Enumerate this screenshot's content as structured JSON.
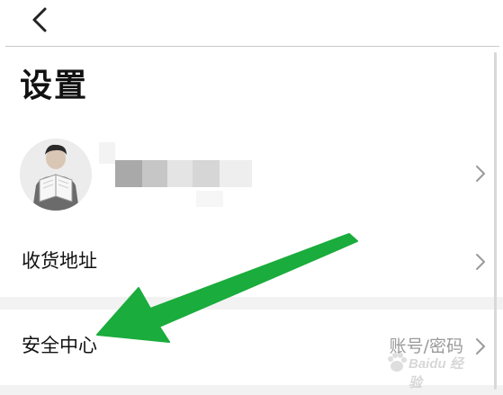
{
  "page": {
    "title": "设置"
  },
  "nav": {
    "back_icon": "chevron-left-icon"
  },
  "profile": {
    "avatar_icon": "user-reading-avatar",
    "name_blurred": true,
    "chevron_icon": "chevron-right-icon"
  },
  "rows": {
    "address": {
      "label": "收货地址",
      "chevron_icon": "chevron-right-icon"
    },
    "security": {
      "label": "安全中心",
      "value": "账号/密码",
      "chevron_icon": "chevron-right-icon"
    }
  },
  "annotation": {
    "arrow_color": "#1aac3c"
  },
  "watermark": {
    "text": "Baidu 经验"
  }
}
